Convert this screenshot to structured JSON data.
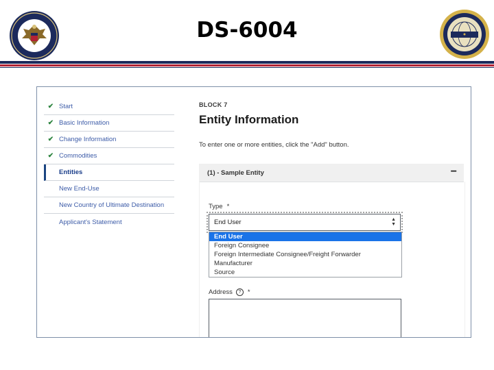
{
  "slide": {
    "title": "DS-6004",
    "colors": {
      "navy": "#1c2a5c",
      "red": "#b22234"
    }
  },
  "sidebar": {
    "items": [
      {
        "label": "Start",
        "completed": true
      },
      {
        "label": "Basic Information",
        "completed": true
      },
      {
        "label": "Change Information",
        "completed": true
      },
      {
        "label": "Commodities",
        "completed": true
      },
      {
        "label": "Entities",
        "active": true
      },
      {
        "label": "New End-Use"
      },
      {
        "label": "New Country of Ultimate Destination"
      },
      {
        "label": "Applicant's Statement"
      }
    ],
    "check_icon": "check-icon"
  },
  "main": {
    "block_label": "BLOCK 7",
    "heading": "Entity Information",
    "instructions": "To enter one or more entities, click the \"Add\" button.",
    "accordion": {
      "title": "(1) - Sample Entity",
      "collapse_symbol": "−"
    },
    "type_field": {
      "label": "Type",
      "required_mark": "*",
      "selected": "End User",
      "options": [
        "End User",
        "Foreign Consignee",
        "Foreign Intermediate Consignee/Freight Forwarder",
        "Manufacturer",
        "Source"
      ]
    },
    "address_field": {
      "label": "Address",
      "required_mark": "*",
      "help_symbol": "?"
    }
  }
}
